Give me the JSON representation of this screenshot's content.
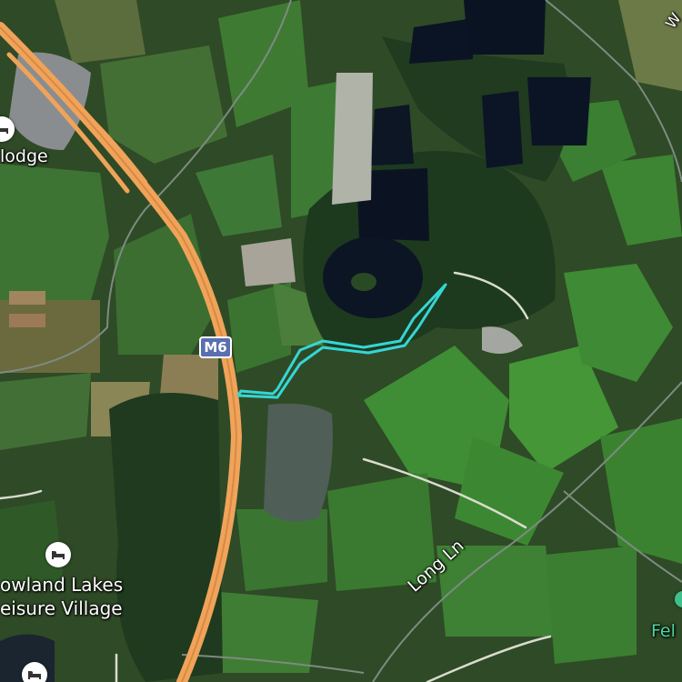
{
  "map": {
    "type": "satellite",
    "colors": {
      "motorway": "#f0a35a",
      "route_highlight": "#35d6d6",
      "water": "#0c1524",
      "field": "#3f7a33",
      "woodland": "#1f3a1e",
      "minor_road": "#d9dccf"
    }
  },
  "labels": {
    "lodge": "lodge",
    "motorway_shield": "M6",
    "lakes_line1": "owland Lakes",
    "lakes_line2": "eisure Village",
    "long_lane": "Long Ln",
    "fel": "Fel",
    "top_right_fragment": "W"
  },
  "icons": {
    "poi_lodge": "hotel-bed-icon",
    "poi_lakes": "hotel-bed-icon",
    "poi_bottom": "hotel-bed-icon",
    "poi_fel": "place-icon"
  }
}
